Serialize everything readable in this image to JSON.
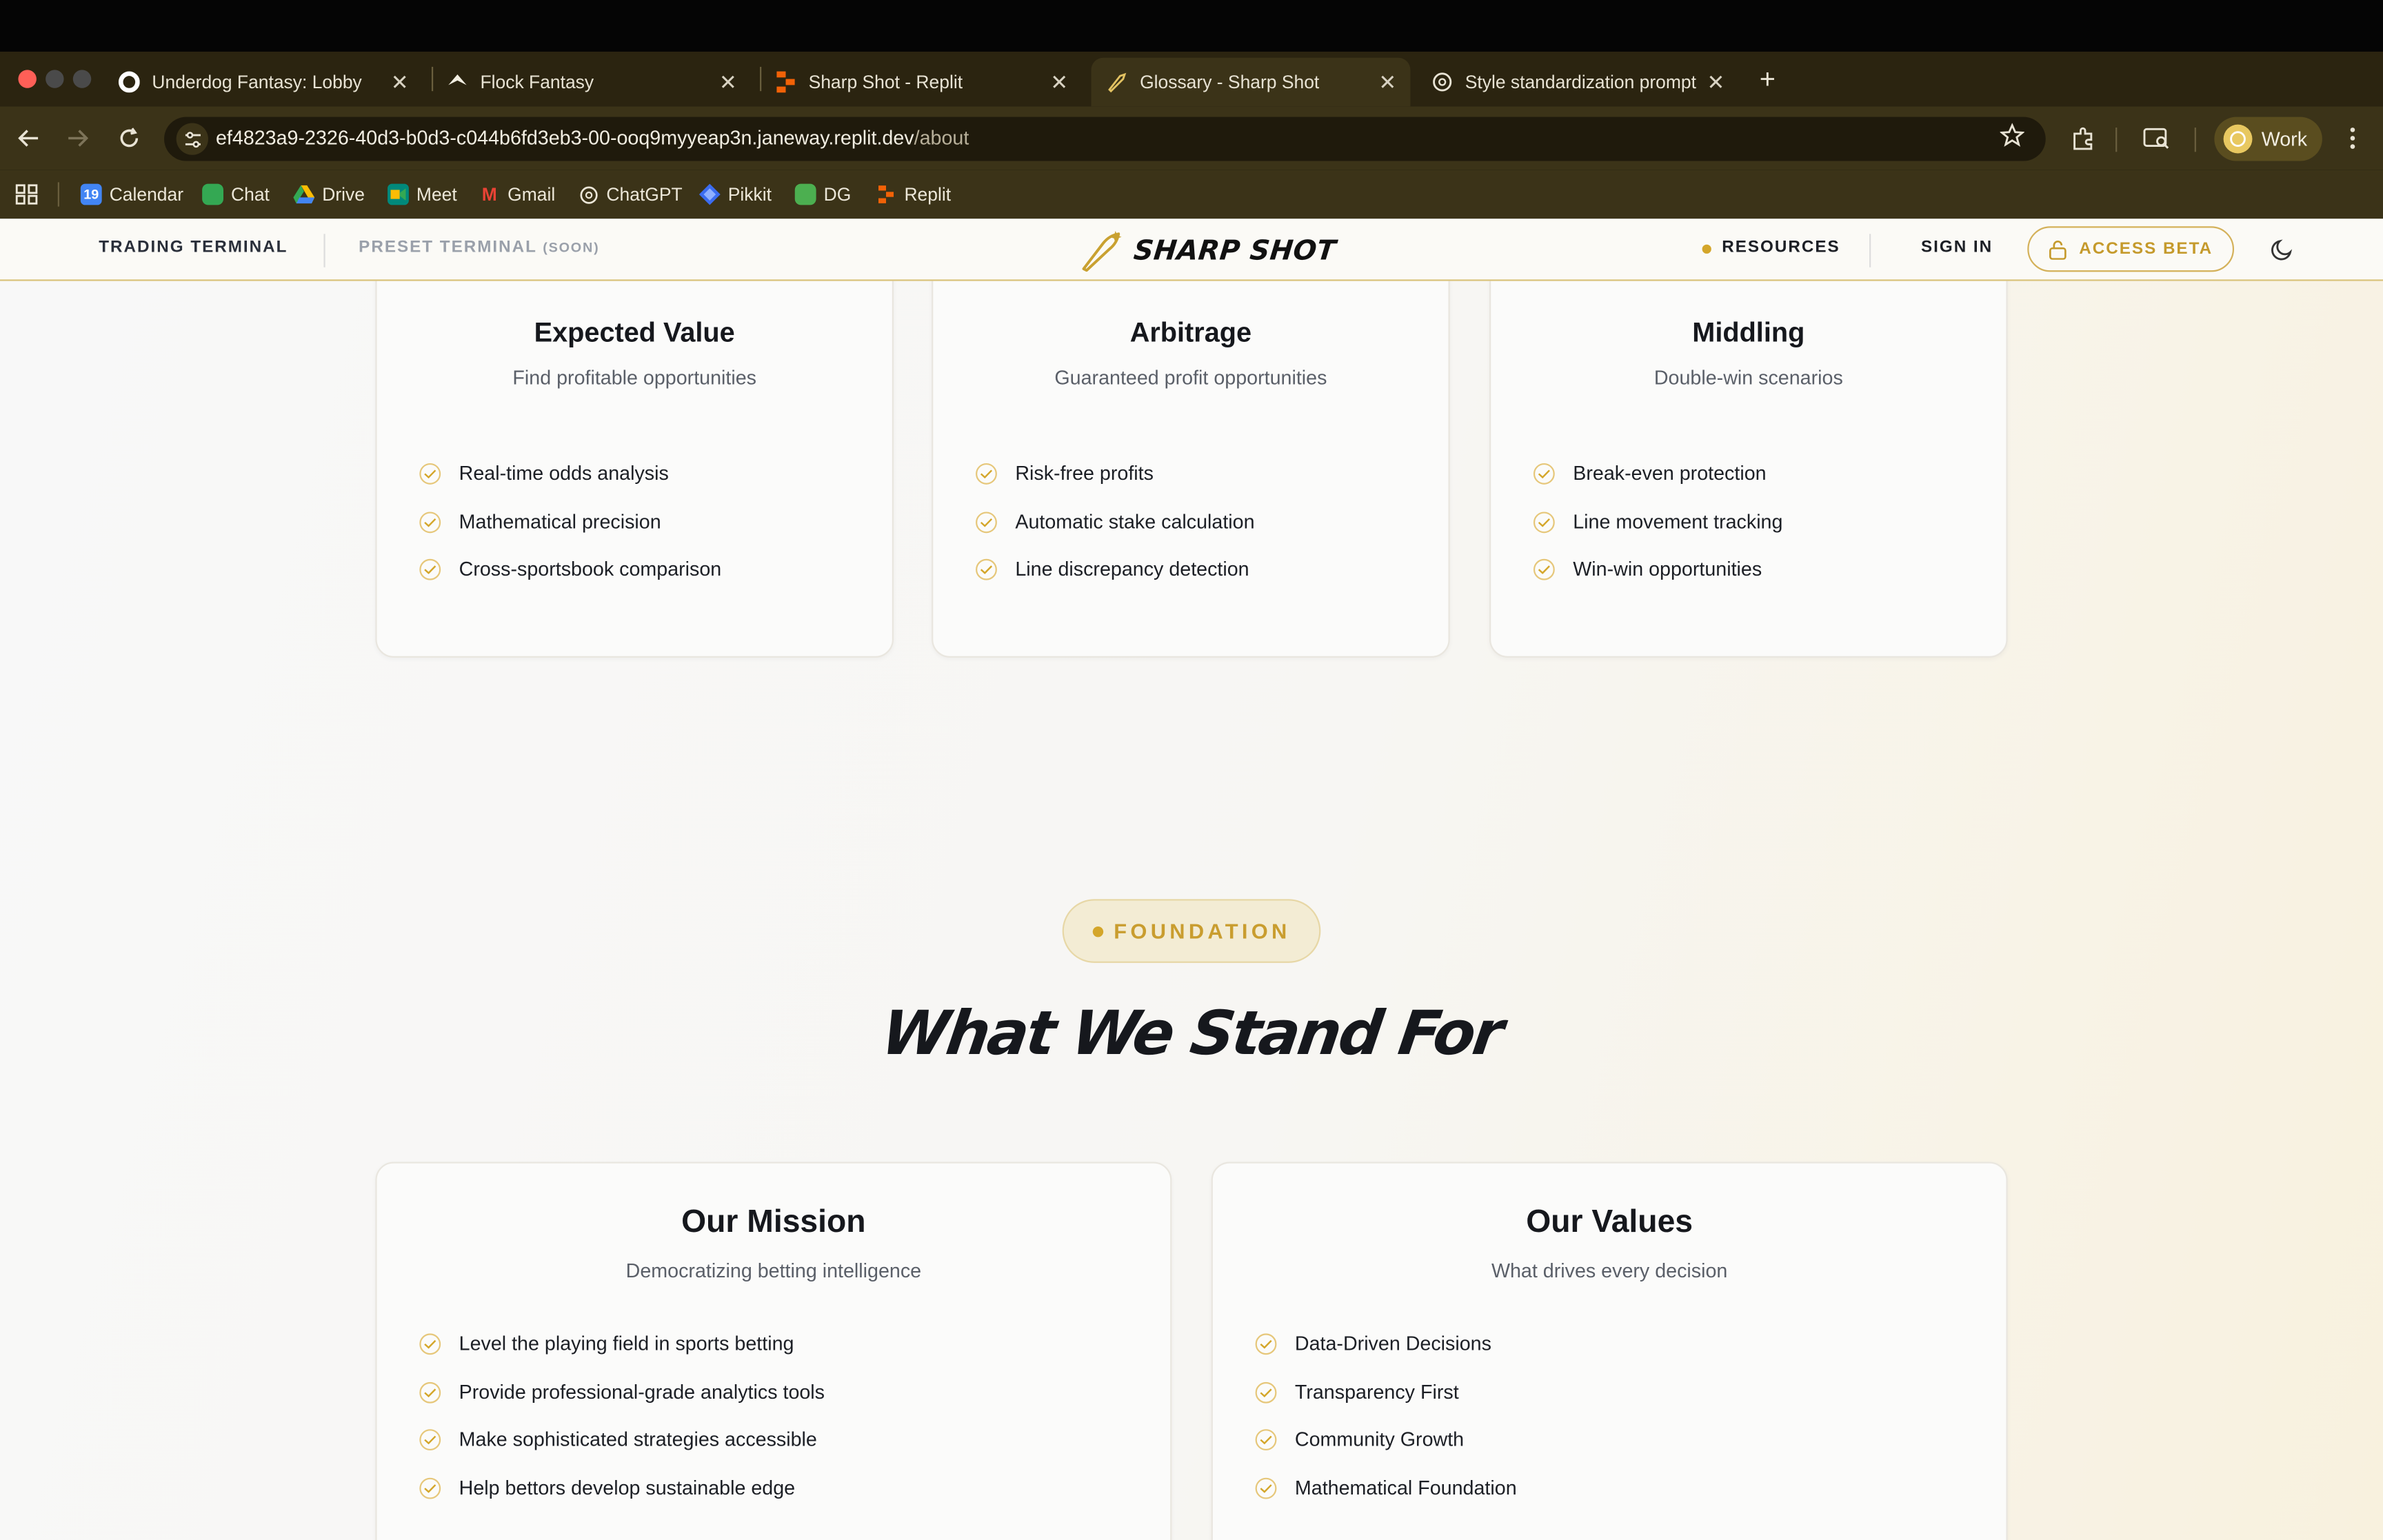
{
  "browser": {
    "tabs": [
      {
        "label": "Underdog Fantasy: Lobby",
        "icon": "underdog-icon"
      },
      {
        "label": "Flock Fantasy",
        "icon": "flock-icon"
      },
      {
        "label": "Sharp Shot - Replit",
        "icon": "replit-icon"
      },
      {
        "label": "Glossary - Sharp Shot",
        "icon": "sharpshot-icon"
      },
      {
        "label": "Style standardization prompt",
        "icon": "chatgpt-icon"
      }
    ],
    "url_host": "ef4823a9-2326-40d3-b0d3-c044b6fd3eb3-00-ooq9myyeap3n.janeway.replit.dev",
    "url_path": "/about",
    "profile_label": "Work",
    "bookmarks": [
      {
        "label": "Calendar",
        "icon": "calendar-icon",
        "color": "#4285f4",
        "glyph": "19"
      },
      {
        "label": "Chat",
        "icon": "chat-icon",
        "color": "#34a853",
        "glyph": ""
      },
      {
        "label": "Drive",
        "icon": "drive-icon",
        "color": "#fbbc04",
        "glyph": ""
      },
      {
        "label": "Meet",
        "icon": "meet-icon",
        "color": "#00897b",
        "glyph": ""
      },
      {
        "label": "Gmail",
        "icon": "gmail-icon",
        "color": "#ea4335",
        "glyph": "M"
      },
      {
        "label": "ChatGPT",
        "icon": "chatgpt-icon",
        "color": "#3b3318",
        "glyph": ""
      },
      {
        "label": "Pikkit",
        "icon": "pikkit-icon",
        "color": "#3b6cf0",
        "glyph": ""
      },
      {
        "label": "DG",
        "icon": "dg-icon",
        "color": "#4caf50",
        "glyph": ""
      },
      {
        "label": "Replit",
        "icon": "replit-icon",
        "color": "#f26207",
        "glyph": ""
      }
    ]
  },
  "site": {
    "nav": {
      "trading_terminal": "TRADING TERMINAL",
      "preset_terminal": "PRESET TERMINAL",
      "preset_soon": "(SOON)",
      "logo_text": "SHARP SHOT",
      "resources": "RESOURCES",
      "sign_in": "SIGN IN",
      "access_beta": "ACCESS BETA"
    },
    "strategy_cards": [
      {
        "title": "Expected Value",
        "subtitle": "Find profitable opportunities",
        "items": [
          "Real-time odds analysis",
          "Mathematical precision",
          "Cross-sportsbook comparison"
        ]
      },
      {
        "title": "Arbitrage",
        "subtitle": "Guaranteed profit opportunities",
        "items": [
          "Risk-free profits",
          "Automatic stake calculation",
          "Line discrepancy detection"
        ]
      },
      {
        "title": "Middling",
        "subtitle": "Double-win scenarios",
        "items": [
          "Break-even protection",
          "Line movement tracking",
          "Win-win opportunities"
        ]
      }
    ],
    "foundation_badge": "FOUNDATION",
    "section_heading": "What We Stand For",
    "foundation_cards": [
      {
        "title": "Our Mission",
        "subtitle": "Democratizing betting intelligence",
        "items": [
          "Level the playing field in sports betting",
          "Provide professional-grade analytics tools",
          "Make sophisticated strategies accessible",
          "Help bettors develop sustainable edge"
        ]
      },
      {
        "title": "Our Values",
        "subtitle": "What drives every decision",
        "items": [
          "Data-Driven Decisions",
          "Transparency First",
          "Community Growth",
          "Mathematical Foundation"
        ]
      }
    ],
    "colors": {
      "accent": "#d4a62a",
      "heading": "#16181d",
      "chrome": "#3b3318"
    }
  }
}
